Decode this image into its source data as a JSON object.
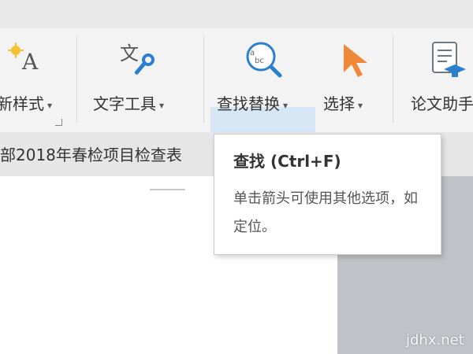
{
  "ribbon": {
    "new_style": {
      "label": "新样式",
      "caret": "▾",
      "icon": "style-icon"
    },
    "text_tools": {
      "label": "文字工具",
      "caret": "▾",
      "icon": "text-tools-icon"
    },
    "find_replace": {
      "label": "查找替换",
      "caret": "▾",
      "icon": "find-replace-icon"
    },
    "select": {
      "label": "选择",
      "caret": "▾",
      "icon": "cursor-arrow-icon"
    },
    "paper_assistant": {
      "label": "论文助手",
      "icon": "paper-assistant-icon"
    }
  },
  "document": {
    "tab_title": "部2018年春检项目检查表"
  },
  "tooltip": {
    "title": "查找 (Ctrl+F)",
    "body": "单击箭头可使用其他选项，如定位。"
  },
  "watermark": "jdhx.net",
  "colors": {
    "ribbon_bg": "#f3f3f3",
    "highlight": "#d6e6f5",
    "doc_gray": "#bfc2c6",
    "accent_orange": "#f0883a",
    "accent_blue": "#2a7fcf"
  }
}
